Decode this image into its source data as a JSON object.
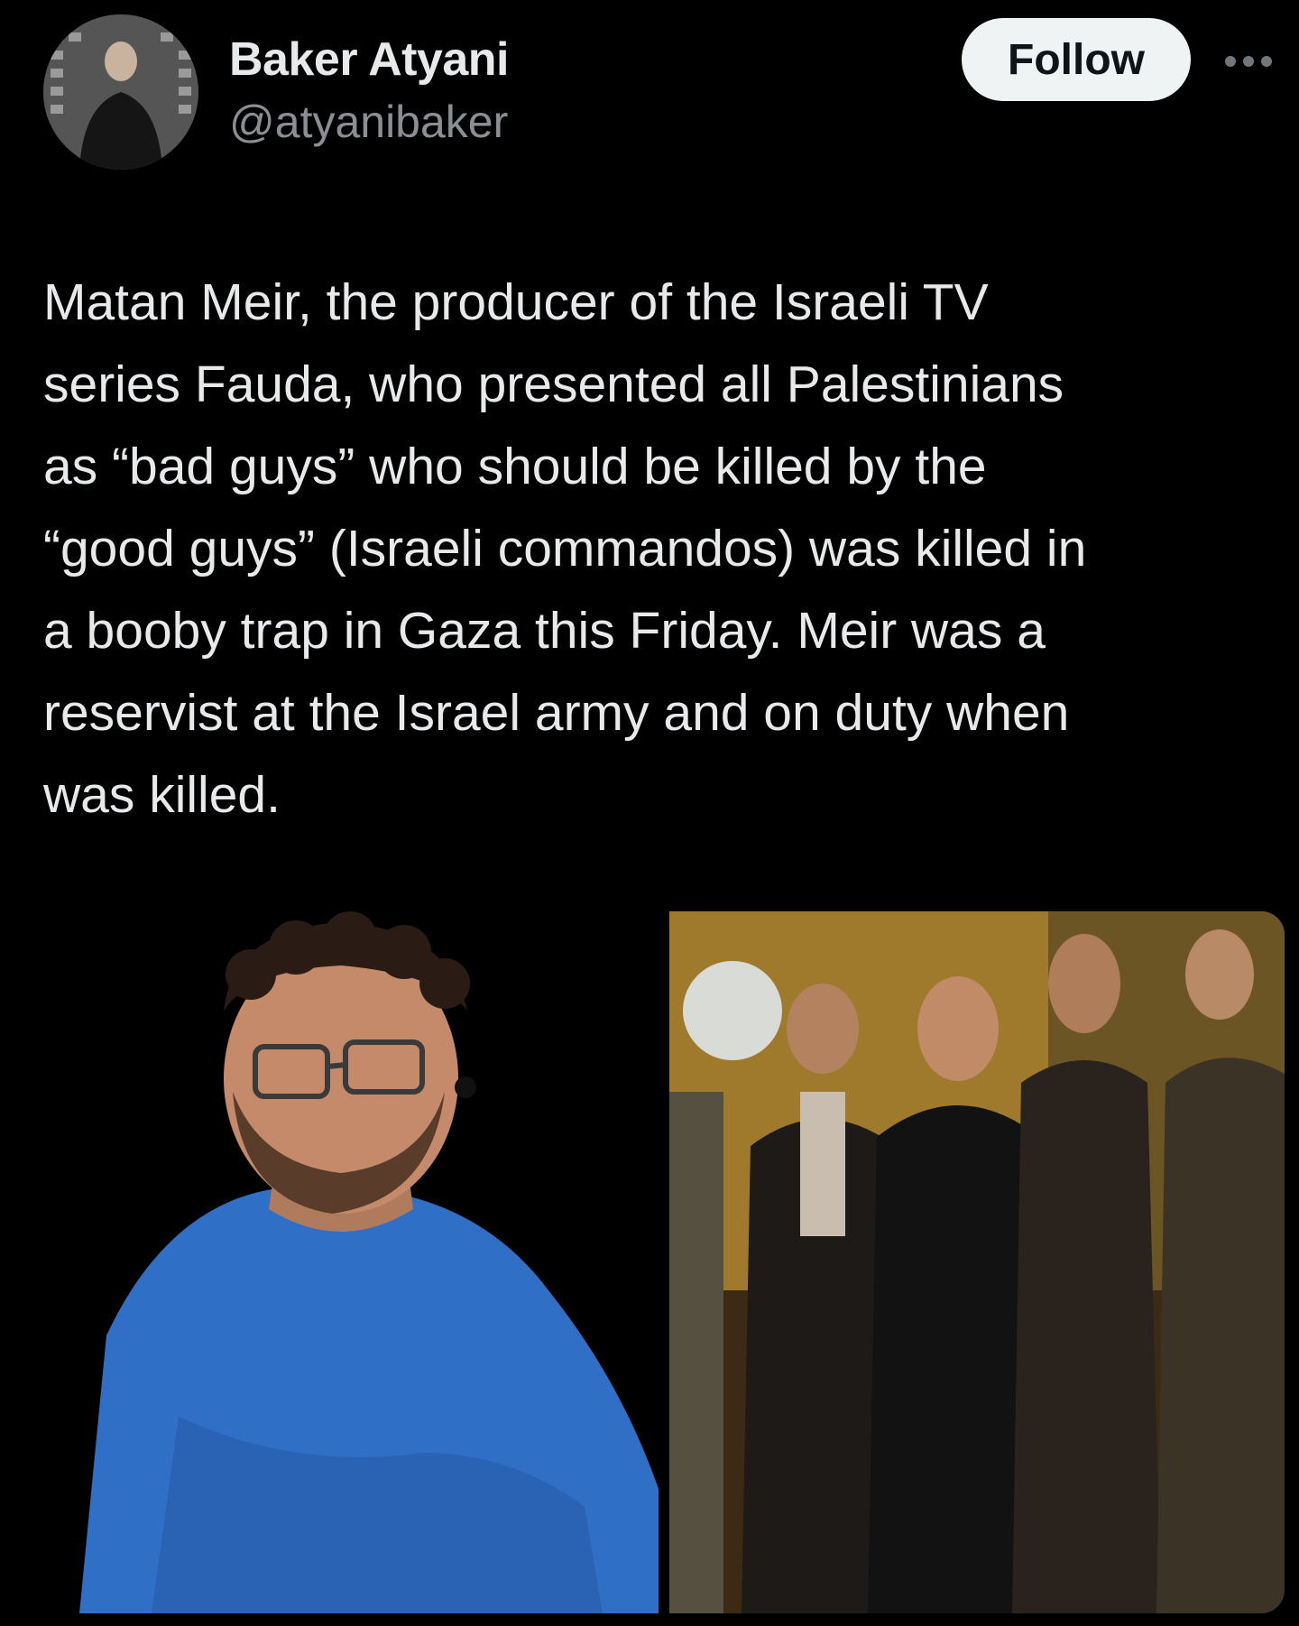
{
  "author": {
    "display_name": "Baker Atyani",
    "handle": "@atyanibaker"
  },
  "actions": {
    "follow_label": "Follow",
    "more_icon": "more-horizontal-icon"
  },
  "tweet": {
    "lines": [
      "Matan Meir, the producer of the Israeli TV",
      "series Fauda, who presented all Palestinians",
      "as “bad guys” who should be killed by the",
      "“good guys” (Israeli commandos) was killed in",
      "a booby trap in Gaza this Friday. Meir was a",
      "reservist at the Israel army and on duty when",
      "was killed."
    ]
  },
  "colors": {
    "background": "#000000",
    "primary_text": "#e7e9ea",
    "secondary_text": "#8b8f94",
    "follow_bg": "#eff3f4",
    "follow_text": "#0f1419"
  }
}
